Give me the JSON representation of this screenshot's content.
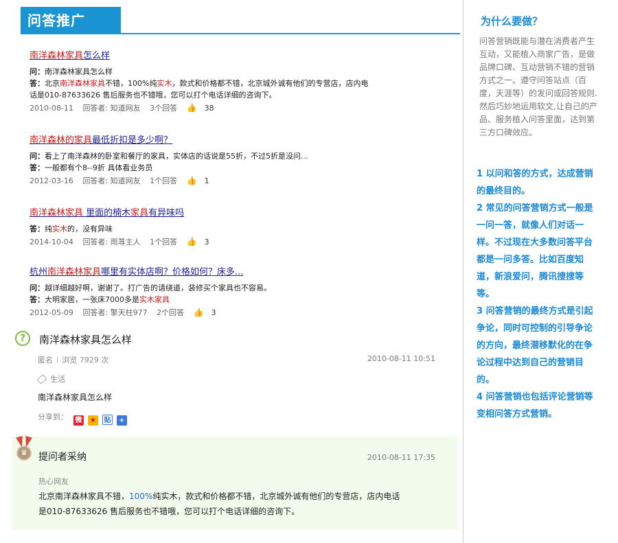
{
  "header": {
    "title": "问答推广"
  },
  "questions": [
    {
      "title_pre": "",
      "title_hl1": "南洋森林家具",
      "title_mid": "怎么样",
      "title_hl2": "",
      "title_post": "",
      "q_label": "问：",
      "q_pre": "南洋森林家具怎么样",
      "q_hl": "",
      "q_post": "",
      "a_label": "答：",
      "a_pre": "北京",
      "a_hl1": "南洋森林家具",
      "a_mid": "不错，100%纯",
      "a_hl2": "实木",
      "a_post": "，款式和价格都不错，北京城外诚有他们的专营店，店内电",
      "a_line2": "话是010-87633626 售后服务也不错哦，您可以打个电话详细的咨询下。",
      "date": "2010-08-11",
      "answerer": "回答者: 知道网友",
      "answers": "3个回答",
      "likes": "38"
    },
    {
      "title_pre": "",
      "title_hl1": "南洋森林的家具",
      "title_mid": "最低折扣是多少啊？",
      "title_hl2": "",
      "title_post": "",
      "q_label": "问：",
      "q_pre": "看上了南洋森林的卧室和餐厅的家具，实体店的话说是55折，不过5折是没问...",
      "q_hl": "",
      "q_post": "",
      "a_label": "答：",
      "a_pre": "一般都有个8--9折 具体看业务员",
      "a_hl1": "",
      "a_mid": "",
      "a_hl2": "",
      "a_post": "",
      "a_line2": "",
      "date": "2012-03-16",
      "answerer": "回答者: 知道网友",
      "answers": "1个回答",
      "likes": "1"
    },
    {
      "title_pre": "",
      "title_hl1": "南洋森林家具",
      "title_mid": " 里面的楠木",
      "title_hl2": "家具",
      "title_post": "有异味吗",
      "q_label": "",
      "q_pre": "",
      "q_hl": "",
      "q_post": "",
      "a_label": "答：",
      "a_pre": "纯",
      "a_hl1": "实木",
      "a_mid": "的，没有异味",
      "a_hl2": "",
      "a_post": "",
      "a_line2": "",
      "date": "2014-10-04",
      "answerer": "回答者: 雨荨主人",
      "answers": "1个回答",
      "likes": "3"
    },
    {
      "title_pre": "杭州",
      "title_hl1": "南洋森林家具",
      "title_mid": "哪里有实体店啊？价格如何？床多...",
      "title_hl2": "",
      "title_post": "",
      "q_label": "问：",
      "q_pre": "越详细越好啊，谢谢了。打广告的请绕道，装修买个家具也不容易。",
      "q_hl": "",
      "q_post": "",
      "a_label": "答：",
      "a_pre": "大明家居，一张床7000多是",
      "a_hl1": "实木家具",
      "a_mid": "",
      "a_hl2": "",
      "a_post": "",
      "a_line2": "",
      "date": "2012-05-09",
      "answerer": "回答者: 擎天柱977",
      "answers": "2个回答",
      "likes": "3"
    }
  ],
  "detail": {
    "title": "南洋森林家具怎么样",
    "author": "匿名",
    "sep": "I",
    "views": "浏览 7929 次",
    "date": "2010-08-11 10:51",
    "tag": "生活",
    "body": "南洋森林家具怎么样",
    "share_label": "分享到："
  },
  "answer": {
    "title": "提问者采纳",
    "date": "2010-08-11 17:35",
    "user": "热心网友",
    "text_pre": "北京南洋森林家具不错，",
    "text_blue": "100%",
    "text_mid": "纯实木，款式和价格都不错，北京城外诚有他们的专营店，店内电话",
    "text_line2": "是010-87633626 售后服务也不错哦，您可以打个电话详细的咨询下。"
  },
  "sidebar": {
    "why": "为什么要做？",
    "desc_lines": [
      "问答营销既能与潜在消费者产生",
      "互动，又能植入商家广告，是做",
      "品牌口碑、互动营销不错的营销",
      "方式之一。遵守问答站点（百",
      "度，天涯等）的发问或回答规则.",
      "然后巧妙地运用软文,让自己的产",
      "品、服务植入问答里面，达到第",
      "三方口碑效应。"
    ],
    "point_lines": [
      "1 以问和答的方式，达成营销",
      "的最终目的。",
      "2 常见的问答营销方式一般是",
      "一问一答，就像人们对话一",
      "样。不过现在大多数问答平台",
      "都是一问多答。比如百度知",
      "道，新浪爱问，腾讯搜搜等",
      "等。",
      "3 问答营销的最终方式是引起",
      "争论，同时可控制的引导争论",
      "的方向，最终潜移默化的在争",
      "论过程中达到自己的营销目",
      "的。",
      "4 问答营销也包括评论营销等",
      "变相问答方式营销。"
    ]
  },
  "colors": {
    "accent": "#1b94d4",
    "highlight": "#c61b1b",
    "link": "#1f1f99",
    "answer_bg": "#f3fbec",
    "sidebar_blue": "#1b8ad6"
  },
  "icons": [
    "thumb-up-icon",
    "question-circle-icon",
    "tag-icon",
    "weibo-icon",
    "qzone-icon",
    "tieba-icon",
    "plus-share-icon",
    "medal-icon"
  ]
}
